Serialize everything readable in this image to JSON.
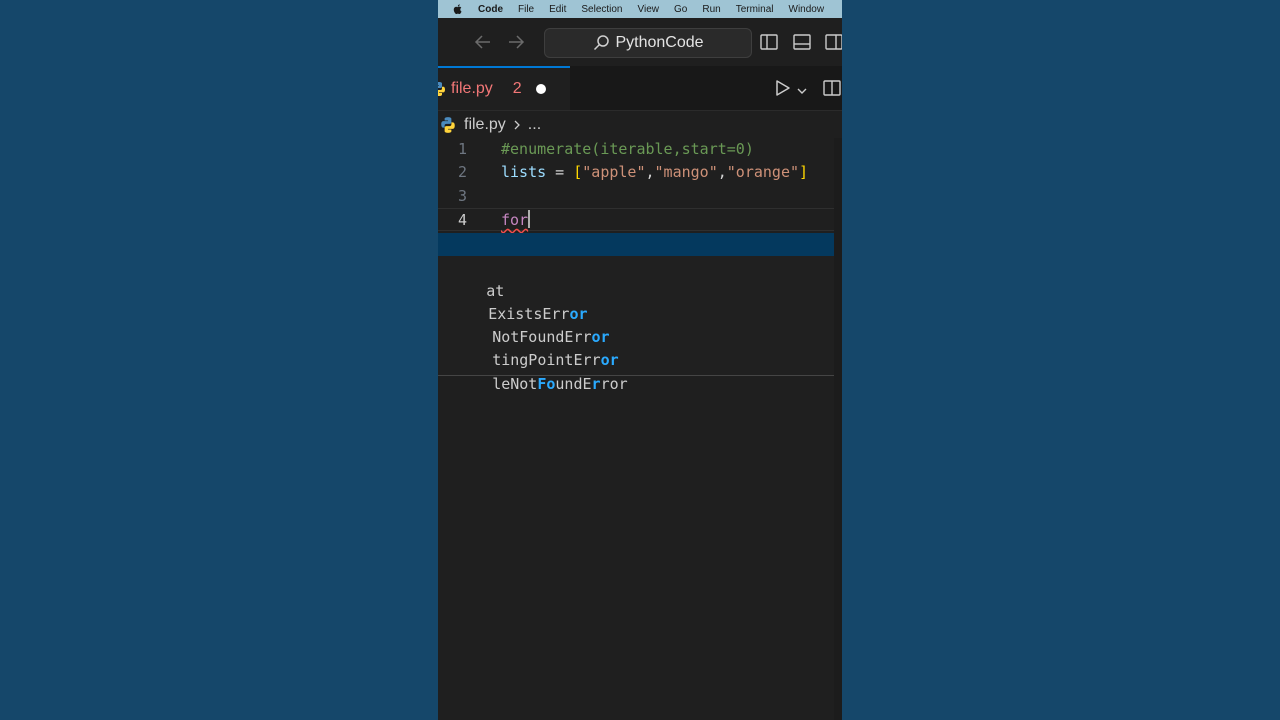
{
  "menubar": {
    "app": "Code",
    "items": [
      "File",
      "Edit",
      "Selection",
      "View",
      "Go",
      "Run",
      "Terminal",
      "Window"
    ]
  },
  "titlebar": {
    "search_text": "PythonCode"
  },
  "tabs": [
    {
      "label": "file.py",
      "problems": "2",
      "dirty": true
    }
  ],
  "breadcrumb": {
    "file": "file.py",
    "more": "..."
  },
  "editor": {
    "active_line": 4,
    "lines": [
      {
        "n": "1",
        "comment": "#enumerate(iterable,start=0)"
      },
      {
        "n": "2",
        "var": "lists",
        "op": " = ",
        "open": "[",
        "s1": "\"apple\"",
        "c1": ",",
        "s2": "\"mango\"",
        "c2": ",",
        "s3": "\"orange\"",
        "close": "]"
      },
      {
        "n": "3"
      },
      {
        "n": "4",
        "kw": "for"
      }
    ]
  },
  "suggest": {
    "items": [
      {
        "label": ""
      },
      {
        "parts": [
          "at"
        ]
      },
      {
        "parts": [
          "ExistsErr",
          "or"
        ]
      },
      {
        "parts": [
          "NotFoundErr",
          "or"
        ]
      },
      {
        "parts": [
          "tingPointErr",
          "or"
        ]
      },
      {
        "parts": [
          "leNot",
          "Fo",
          "undE",
          "r",
          "ror"
        ]
      }
    ]
  },
  "colors": {
    "accent": "#0078d4",
    "error_text": "#f27777",
    "suggest_highlight": "#2aaaff",
    "selected_row": "#04395e"
  }
}
